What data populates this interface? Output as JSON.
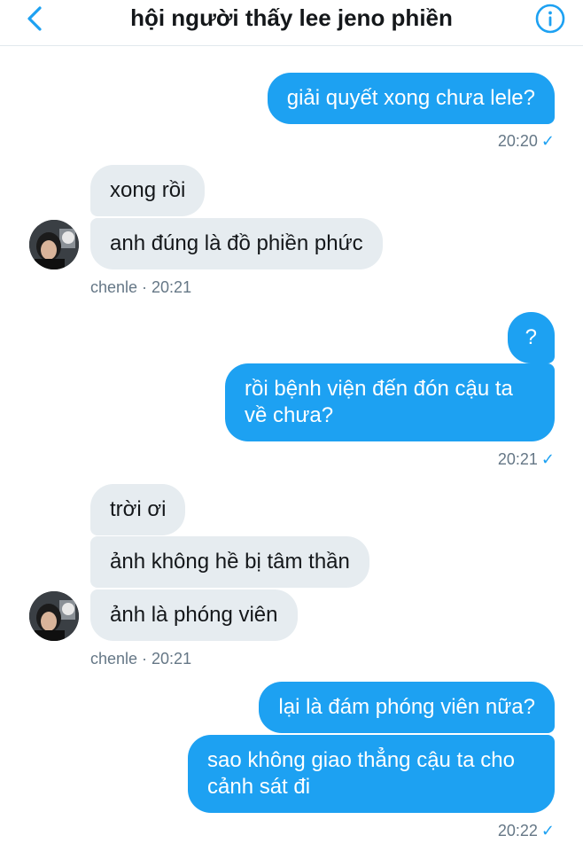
{
  "header": {
    "title": "hội người thấy lee jeno phiền"
  },
  "messages": {
    "m1": "giải quyết xong chưa lele?",
    "t1": "20:20",
    "m2": "xong rồi",
    "m3": "anh đúng là đồ phiền phức",
    "t2": "chenle · 20:21",
    "m4": "?",
    "m5_line1": "rồi bệnh viện đến đón cậu ta",
    "m5_line2": "về chưa?",
    "t3": "20:21",
    "m6": "trời ơi",
    "m7": "ảnh không hề bị tâm thần",
    "m8": "ảnh là phóng viên",
    "t4": "chenle · 20:21",
    "m9": "lại là đám phóng viên nữa?",
    "m10_line1": "sao không giao thẳng cậu ta cho",
    "m10_line2": "cảnh sát đi",
    "t5": "20:22"
  },
  "icons": {
    "back": "chevron-left-icon",
    "info": "info-icon",
    "read": "checkmark-icon"
  },
  "colors": {
    "accent": "#1da1f2",
    "incoming_bubble": "#e6ecf0",
    "meta_text": "#657786"
  }
}
